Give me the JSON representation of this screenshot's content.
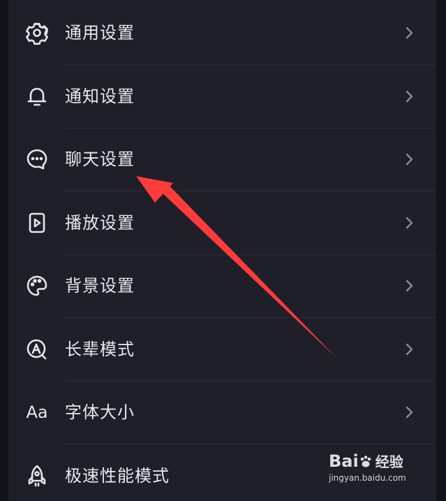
{
  "settings": {
    "items": [
      {
        "label": "通用设置",
        "icon": "gear-icon"
      },
      {
        "label": "通知设置",
        "icon": "bell-icon"
      },
      {
        "label": "聊天设置",
        "icon": "chat-bubble-icon"
      },
      {
        "label": "播放设置",
        "icon": "play-icon"
      },
      {
        "label": "背景设置",
        "icon": "palette-icon"
      },
      {
        "label": "长辈模式",
        "icon": "elder-mode-icon"
      },
      {
        "label": "字体大小",
        "icon": "font-size-icon",
        "glyph": "Aa"
      },
      {
        "label": "极速性能模式",
        "icon": "rocket-icon"
      }
    ]
  },
  "watermark": {
    "brand_prefix": "Bai",
    "brand_suffix": "经验",
    "site": "jingyan.baidu.com"
  },
  "colors": {
    "background": "#121219",
    "panel": "#1e1f29",
    "text": "#e8e8ec",
    "chevron": "#8a8b94",
    "annotation_arrow": "#ff3b3b"
  }
}
